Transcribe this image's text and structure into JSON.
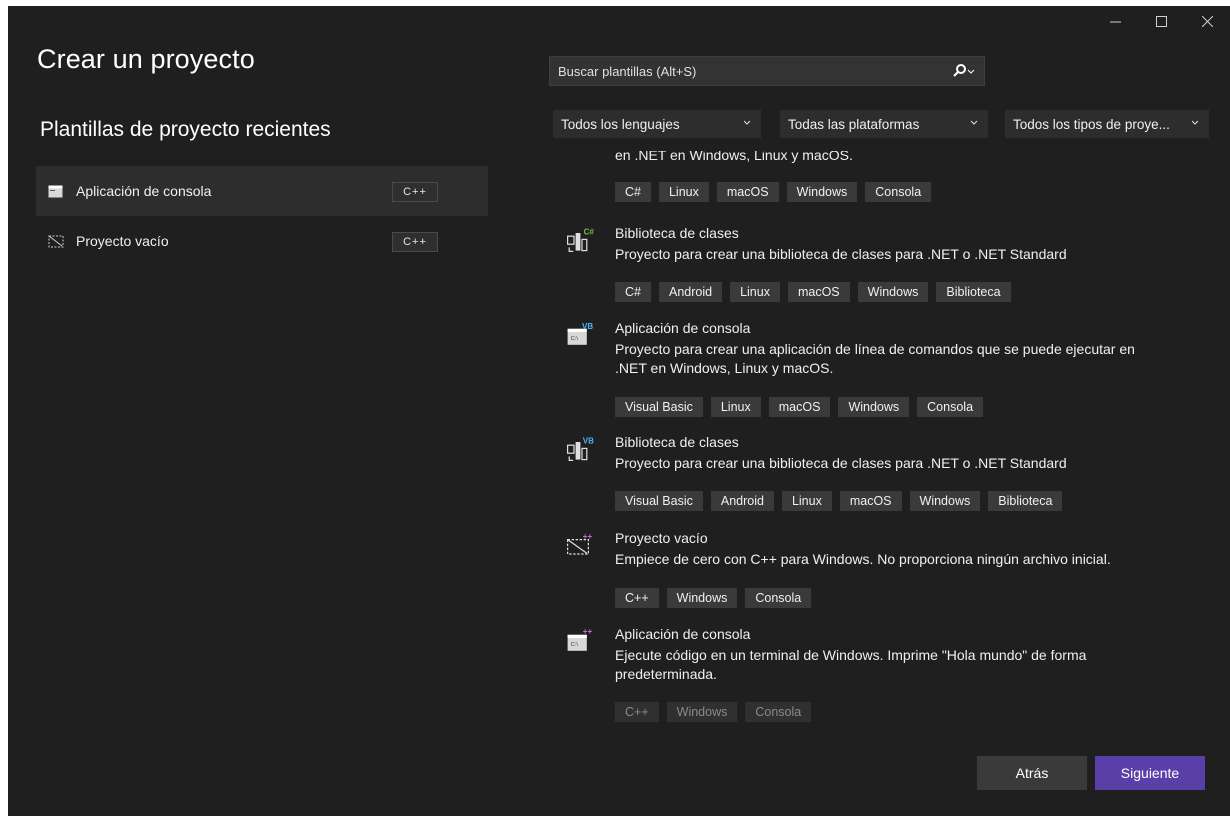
{
  "window": {
    "controls": [
      "minimize",
      "maximize",
      "close"
    ]
  },
  "title": "Crear un proyecto",
  "recent": {
    "heading": "Plantillas de proyecto recientes",
    "items": [
      {
        "label": "Aplicación de consola",
        "lang": "C++",
        "icon": "console-app-icon",
        "selected": true
      },
      {
        "label": "Proyecto vacío",
        "lang": "C++",
        "icon": "empty-project-icon",
        "selected": false
      }
    ]
  },
  "search": {
    "placeholder": "Buscar plantillas (Alt+S)",
    "value": ""
  },
  "filters": {
    "language": "Todos los lenguajes",
    "platform": "Todas las plataformas",
    "project_type": "Todos los tipos de proye..."
  },
  "templates": [
    {
      "title": "",
      "description": "en .NET en Windows, Linux y macOS.",
      "tags": [
        "C#",
        "Linux",
        "macOS",
        "Windows",
        "Consola"
      ],
      "icon": "",
      "badge": ""
    },
    {
      "title": "Biblioteca de clases",
      "description": "Proyecto para crear una biblioteca de clases para .NET o .NET Standard",
      "tags": [
        "C#",
        "Android",
        "Linux",
        "macOS",
        "Windows",
        "Biblioteca"
      ],
      "icon": "class-library-icon",
      "badge": "C#"
    },
    {
      "title": "Aplicación de consola",
      "description": "Proyecto para crear una aplicación de línea de comandos que se puede ejecutar en .NET en Windows, Linux y macOS.",
      "tags": [
        "Visual Basic",
        "Linux",
        "macOS",
        "Windows",
        "Consola"
      ],
      "icon": "console-app-icon",
      "badge": "VB"
    },
    {
      "title": "Biblioteca de clases",
      "description": "Proyecto para crear una biblioteca de clases para .NET o .NET Standard",
      "tags": [
        "Visual Basic",
        "Android",
        "Linux",
        "macOS",
        "Windows",
        "Biblioteca"
      ],
      "icon": "class-library-icon",
      "badge": "VB"
    },
    {
      "title": "Proyecto vacío",
      "description": "Empiece de cero con C++ para Windows. No proporciona ningún archivo inicial.",
      "tags": [
        "C++",
        "Windows",
        "Consola"
      ],
      "icon": "empty-project-icon",
      "badge": "++"
    },
    {
      "title": "Aplicación de consola",
      "description": "Ejecute código en un terminal de Windows. Imprime \"Hola mundo\" de forma predeterminada.",
      "tags": [
        "C++",
        "Windows",
        "Consola"
      ],
      "icon": "console-app-icon",
      "badge": "++"
    }
  ],
  "buttons": {
    "back": "Atrás",
    "next": "Siguiente"
  },
  "colors": {
    "background": "#1f1f1f",
    "accent": "#5a3fa8",
    "badge_csharp": "#6cc04a",
    "badge_vb": "#4cb4f0",
    "badge_cpp": "#c478d8"
  }
}
